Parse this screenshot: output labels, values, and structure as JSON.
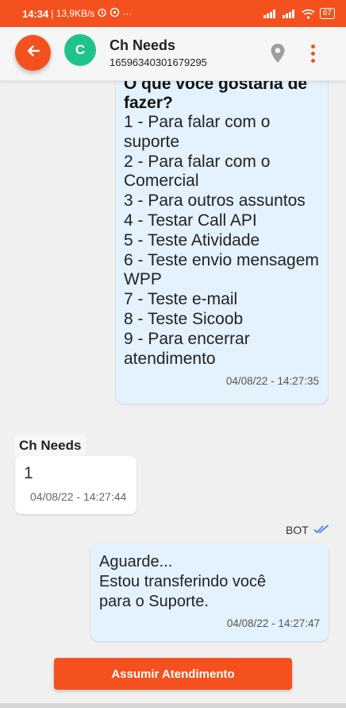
{
  "status_bar": {
    "time": "14:34",
    "speed": "| 13,9KB/s",
    "dots": "···",
    "battery": "67"
  },
  "header": {
    "avatar_letter": "C",
    "contact_name": "Ch Needs",
    "contact_number": "16596340301679295"
  },
  "messages": {
    "bot_menu": {
      "title": "O que você gostaria de fazer?",
      "items": [
        "1 - Para falar com o suporte",
        "2 - Para falar com o Comercial",
        "3 - Para outros assuntos",
        "4 - Testar Call API",
        "5 - Teste Atividade",
        "6 - Teste envio mensagem WPP",
        "7 - Teste e-mail",
        "8 - Teste Sicoob",
        "9 - Para encerrar atendimento"
      ],
      "time": "04/08/22 - 14:27:35"
    },
    "user_reply": {
      "sender": "Ch Needs",
      "text": "1",
      "time": "04/08/22 - 14:27:44"
    },
    "bot_reply": {
      "label": "BOT",
      "lines": [
        "Aguarde...",
        "Estou transferindo você",
        "para o Suporte."
      ],
      "time": "04/08/22 - 14:27:47"
    }
  },
  "actions": {
    "assume_label": "Assumir Atendimento"
  },
  "colors": {
    "accent": "#f4511e",
    "avatar": "#1ec48a",
    "bot_bubble": "#e3f2fd",
    "read_check": "#2979ff"
  }
}
